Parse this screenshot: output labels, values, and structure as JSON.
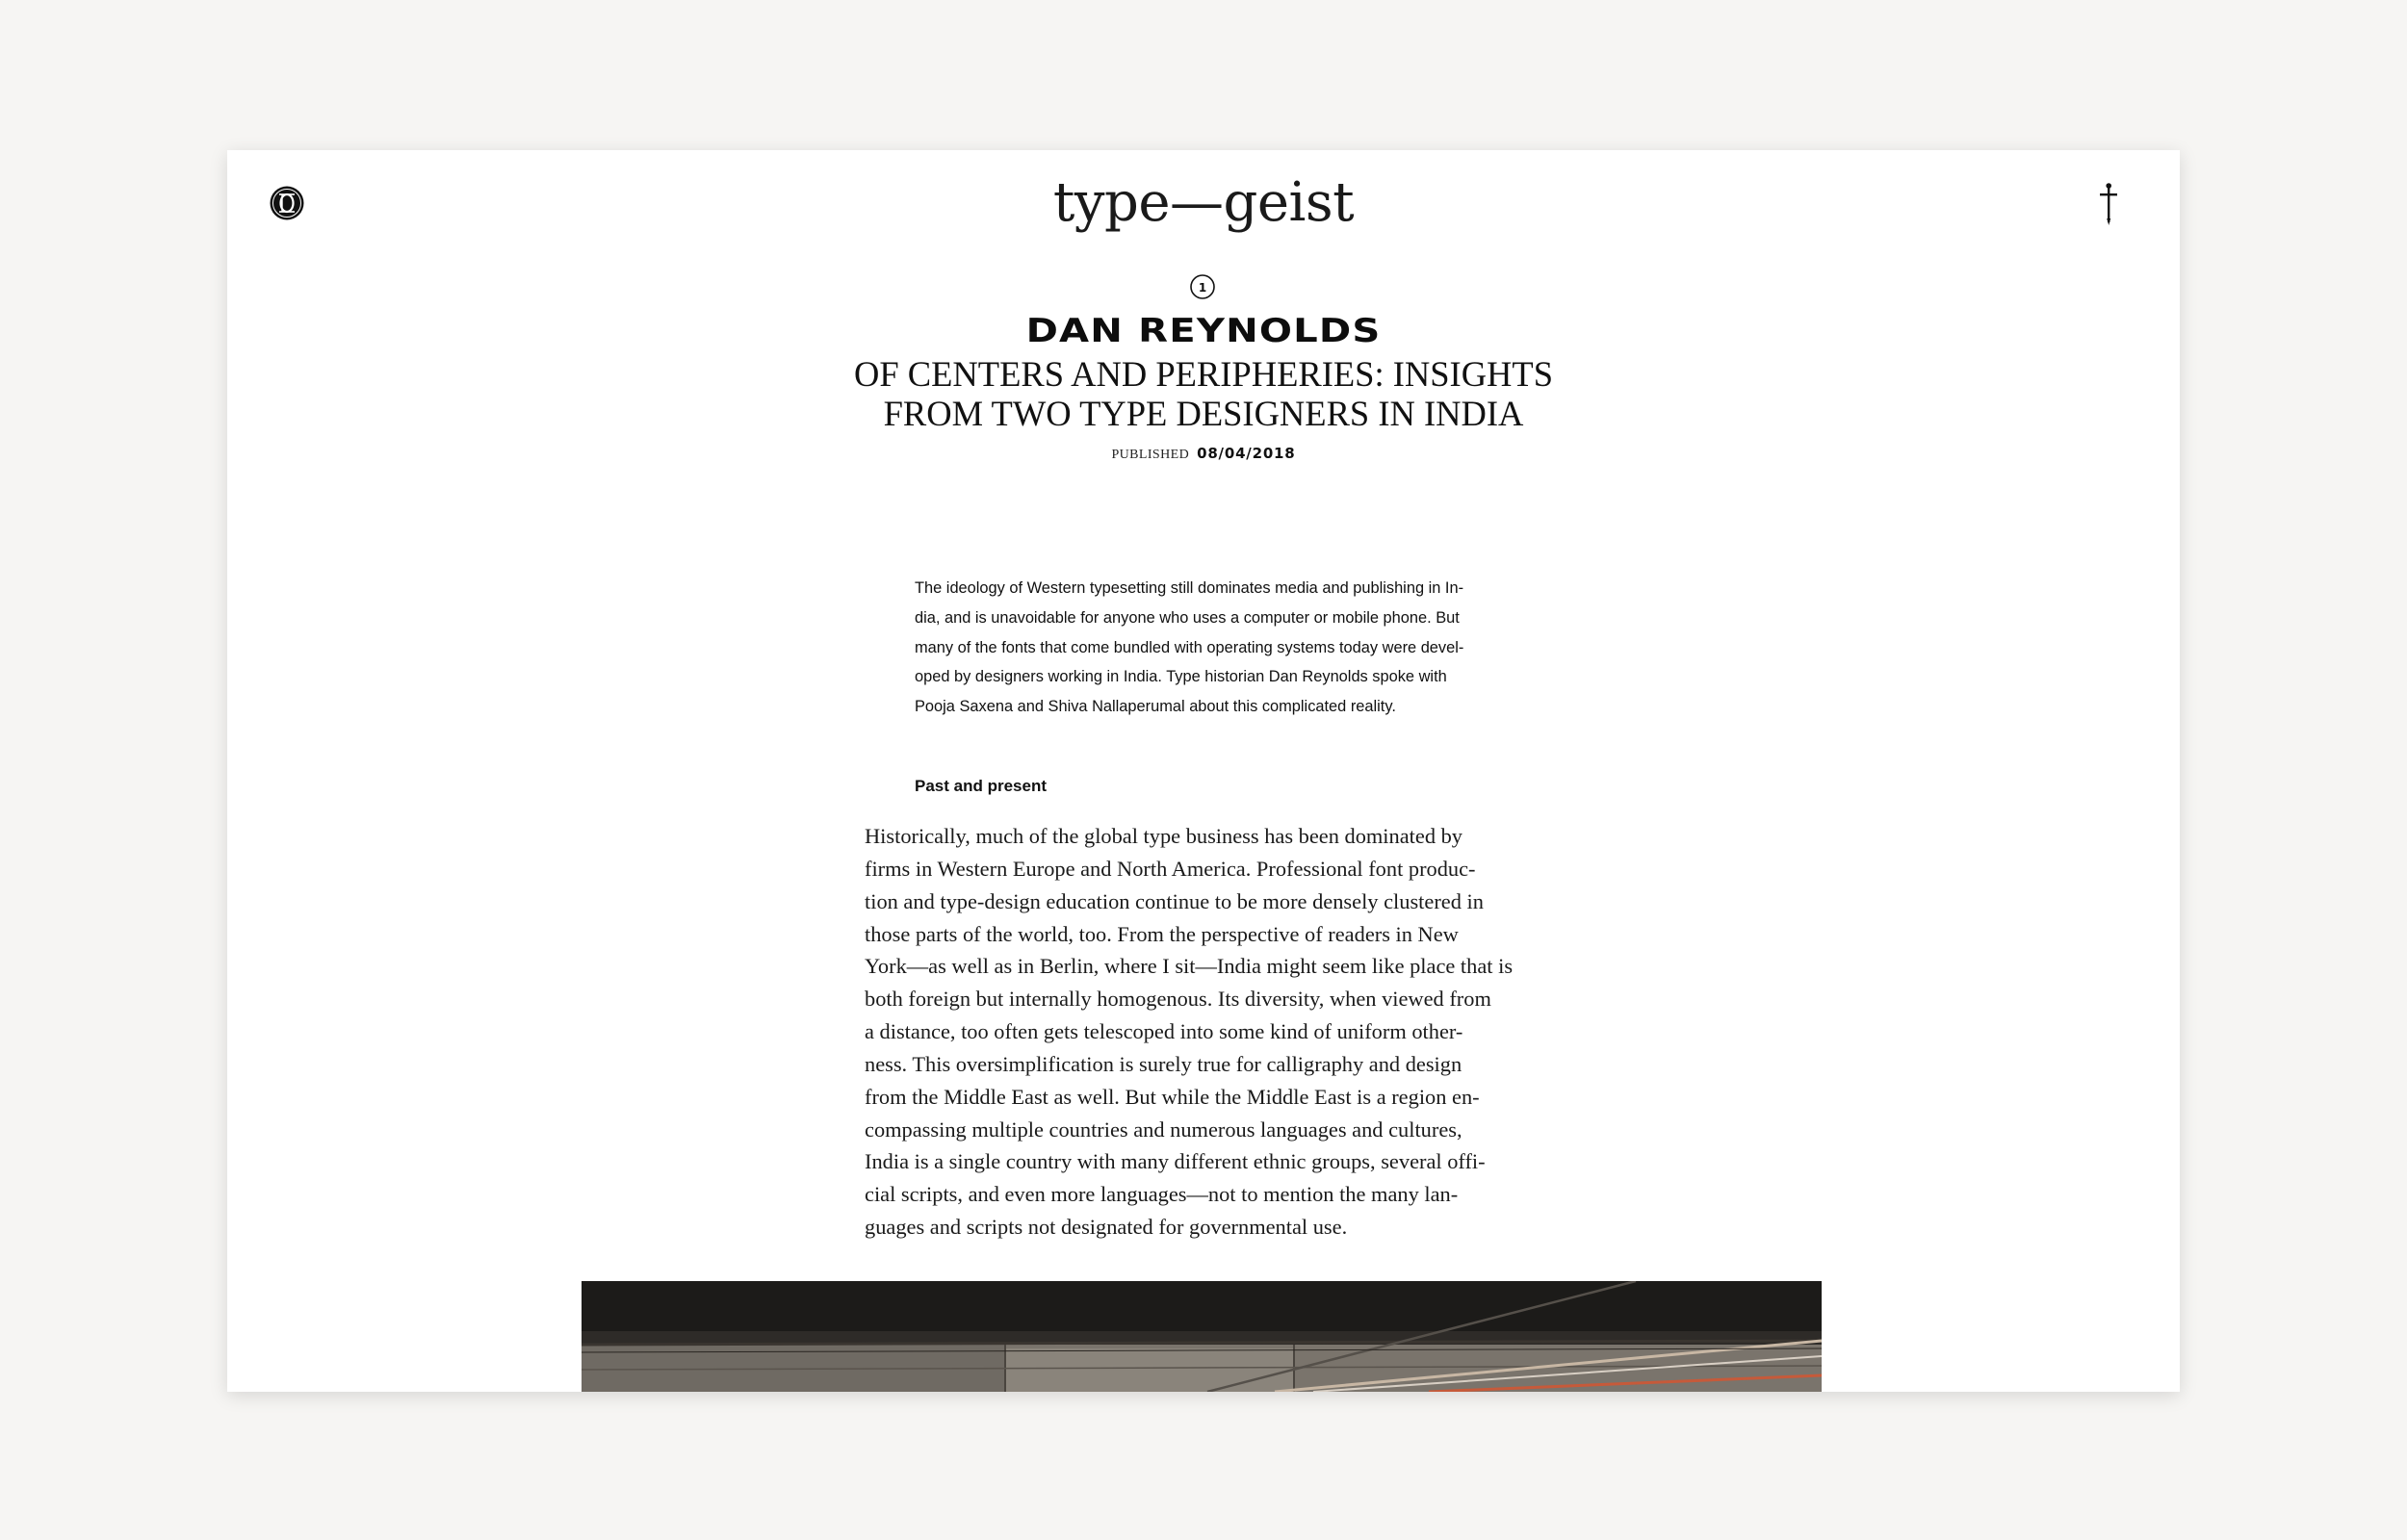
{
  "site": {
    "name": "type—geist"
  },
  "icons": {
    "logo": "monogram-seal-icon",
    "menu": "dagger-menu-icon",
    "article_number": "circled-number-icon"
  },
  "article": {
    "number": "1",
    "author": "DAN REYNOLDS",
    "title_lines": [
      "OF CENTERS AND PERIPHERIES: INSIGHTS",
      "FROM TWO TYPE DESIGNERS IN INDIA"
    ],
    "published_label": "PUBLISHED",
    "published_date": "08/04/2018",
    "intro_lines": [
      "The ideology of Western typesetting still dominates media and publishing in In-",
      "dia, and is unavoidable for anyone who uses a computer or mobile phone. But",
      "many of the fonts that come bundled with operating systems today were devel-",
      "oped by designers working in India. Type historian Dan Reynolds spoke with",
      "Pooja Saxena and Shiva Nallaperumal about this complicated reality."
    ],
    "section_heading": "Past and present",
    "body_lines": [
      "Historically, much of the global type business has been dominated by",
      "firms in Western Europe and North America. Professional font produc-",
      "tion and type-design education continue to be more densely clustered in",
      "those parts of the world, too. From the perspective of readers in New",
      "York—as well as in Berlin, where I sit—India might seem like place that is",
      "both foreign but internally homogenous. Its diversity, when viewed from",
      "a distance, too often gets telescoped into some kind of uniform other-",
      "ness. This oversimplification is surely true for calligraphy and design",
      "from the Middle East as well. But while the Middle East is a region en-",
      "compassing multiple countries and numerous languages and cultures,",
      "India is a single country with many different ethnic groups, several offi-",
      "cial scripts, and even more languages—not to mention the many lan-",
      "guages and scripts not designated for governmental use."
    ]
  },
  "colors": {
    "page_background": "#ffffff",
    "outer_background": "#f6f5f3",
    "text": "#111111"
  }
}
